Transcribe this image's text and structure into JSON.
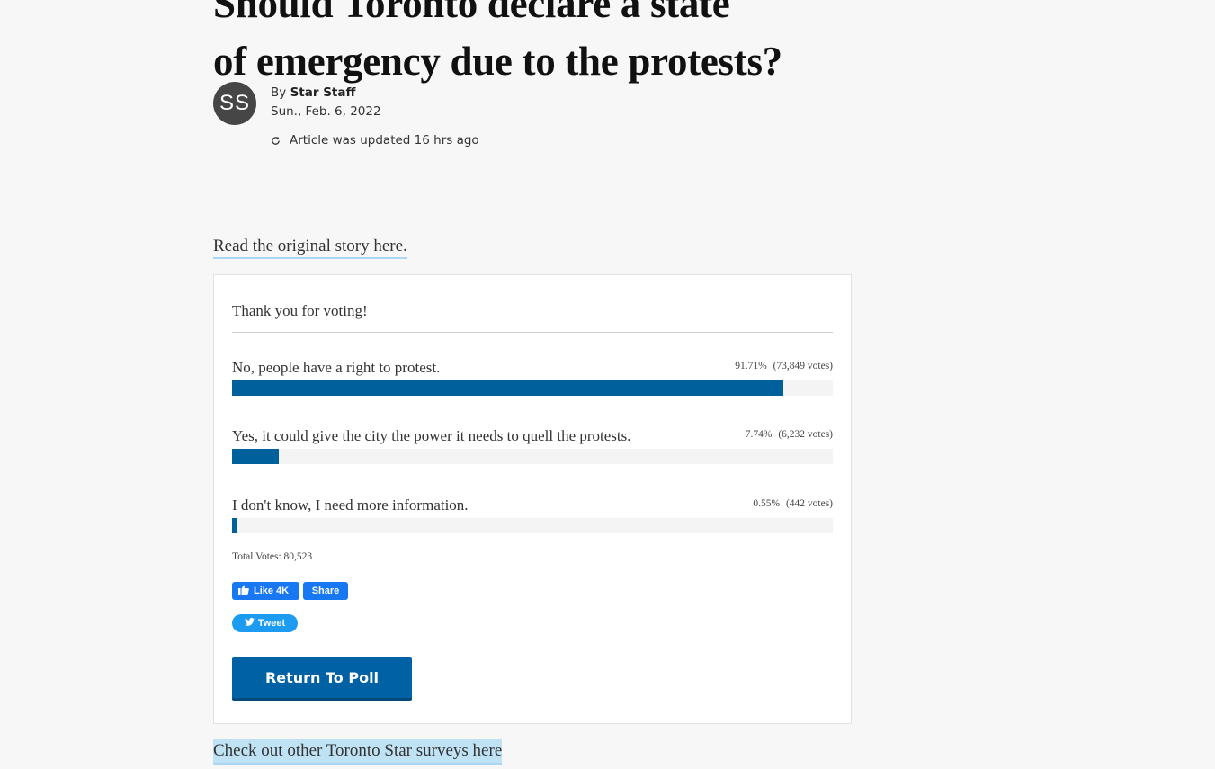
{
  "article": {
    "headline_line1": "Should Toronto declare a state",
    "headline_line2": "of emergency due to the protests?",
    "avatar_initials": "SS",
    "by_prefix": "By",
    "author": "Star Staff",
    "date": "Sun., Feb. 6, 2022",
    "updated": "Article was updated 16 hrs ago",
    "original_story_link": "Read the original story here."
  },
  "poll": {
    "thanks": "Thank you for voting!",
    "options": [
      {
        "label": "No, people have a right to protest.",
        "percent": "91.71%",
        "votes": "(73,849 votes)",
        "fraction": 0.9171
      },
      {
        "label": "Yes, it could give the city the power it needs to quell the protests.",
        "percent": "7.74%",
        "votes": "(6,232 votes)",
        "fraction": 0.0774
      },
      {
        "label": "I don't know, I need more information.",
        "percent": "0.55%",
        "votes": "(442 votes)",
        "fraction": 0.0055
      }
    ],
    "total_votes": "Total Votes: 80,523",
    "fb_like_label": "Like 4K",
    "fb_share_label": "Share",
    "tweet_label": "Tweet",
    "return_button": "Return To Poll",
    "bar_color": "#00609c"
  },
  "footer": {
    "surveys_link": "Check out other Toronto Star surveys here"
  }
}
